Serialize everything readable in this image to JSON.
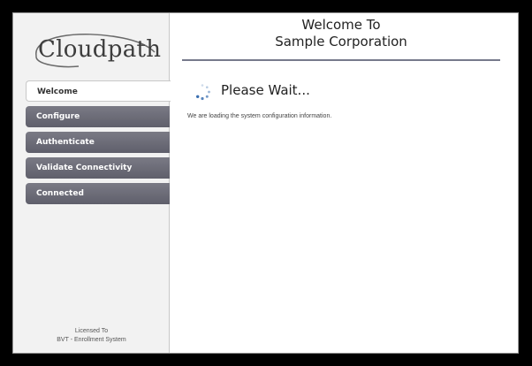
{
  "logo": {
    "text": "Cloudpath"
  },
  "nav": {
    "items": [
      {
        "label": "Welcome",
        "active": true
      },
      {
        "label": "Configure",
        "active": false
      },
      {
        "label": "Authenticate",
        "active": false
      },
      {
        "label": "Validate Connectivity",
        "active": false
      },
      {
        "label": "Connected",
        "active": false
      }
    ]
  },
  "license": {
    "line1": "Licensed To",
    "line2": "BVT - Enrollment System"
  },
  "header": {
    "title_line1": "Welcome To",
    "title_line2": "Sample Corporation"
  },
  "status": {
    "heading": "Please Wait...",
    "message": "We are loading the system configuration information.",
    "spinner_icon": "loading-spinner-icon"
  },
  "colors": {
    "nav_bg": "#6b6b76",
    "rule": "#777a8c",
    "spinner": "#3a6fb0"
  }
}
